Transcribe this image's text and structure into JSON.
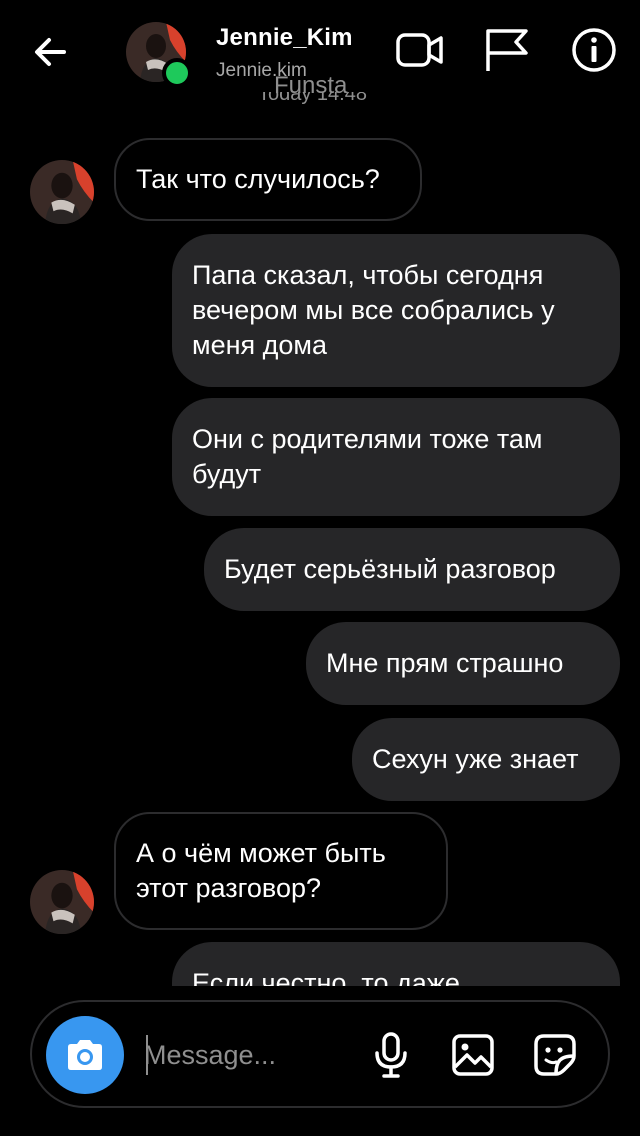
{
  "header": {
    "name": "Jennie_Kim",
    "username": "Jennie.kim",
    "icons": [
      "back-arrow-icon",
      "video-call-icon",
      "flag-icon",
      "info-icon"
    ],
    "online_color": "#1ec95b"
  },
  "overlay_text": "Funsta",
  "timestamp": "Today 14:48",
  "messages": [
    {
      "from": "them",
      "text": "Так что случилось?"
    },
    {
      "from": "me",
      "text": "Папа сказал, чтобы сегодня вечером мы все собрались у меня дома"
    },
    {
      "from": "me",
      "text": "Они с родителями тоже там будут"
    },
    {
      "from": "me",
      "text": "Будет серьёзный разговор"
    },
    {
      "from": "me",
      "text": "Мне прям страшно"
    },
    {
      "from": "me",
      "text": "Сехун уже знает"
    },
    {
      "from": "them",
      "text": "А о чём может быть этот разговор?"
    },
    {
      "from": "me",
      "text": "Если честно, то даже"
    }
  ],
  "composer": {
    "placeholder": "Message...",
    "icons": [
      "camera-icon",
      "microphone-icon",
      "gallery-icon",
      "sticker-icon"
    ],
    "camera_color": "#3897f0"
  },
  "colors": {
    "background": "#000000",
    "outgoing_bubble": "#262628",
    "incoming_border": "#2c2c2e",
    "secondary_text": "#a8a8a8"
  }
}
